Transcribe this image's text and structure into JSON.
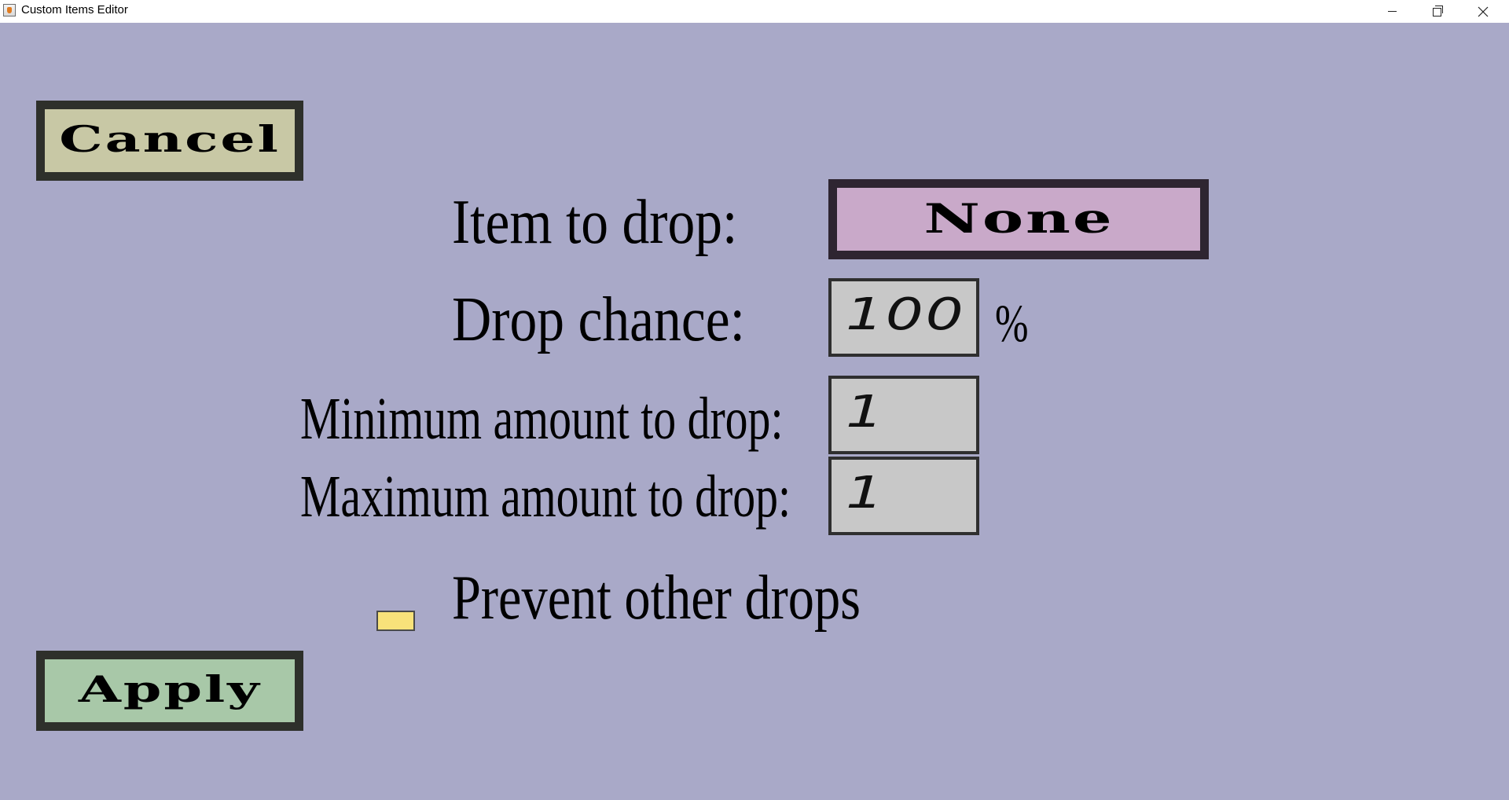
{
  "window": {
    "title": "Custom Items Editor",
    "icon": "java-cup-icon",
    "controls": [
      "minimize-icon",
      "restore-icon",
      "close-icon"
    ]
  },
  "buttons": {
    "cancel": "Cancel",
    "apply": "Apply",
    "item_select": "None"
  },
  "form": {
    "item_label": "Item to drop:",
    "chance_label": "Drop chance:",
    "chance_value": "100",
    "chance_unit": "%",
    "min_label": "Minimum amount to drop:",
    "min_value": "1",
    "max_label": "Maximum amount to drop:",
    "max_value": "1",
    "prevent_label": "Prevent other drops",
    "prevent_checked": false
  },
  "colors": {
    "background": "#a9a9c8",
    "cancel_button": "#c8c8a5",
    "apply_button": "#a8c8a8",
    "item_button": "#c9a9c9",
    "checkbox_fill": "#f8e27a",
    "field_fill": "#c8c8c8"
  }
}
